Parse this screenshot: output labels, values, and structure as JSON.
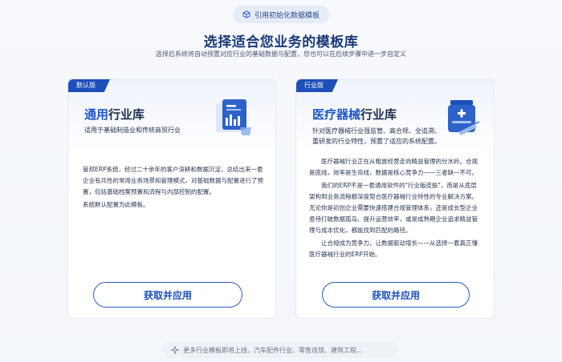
{
  "top_pill": {
    "label": "引用初始化数据模板",
    "icon": "cube-icon"
  },
  "title": "选择适合您业务的模板库",
  "subtitle": "选择后系统将自动预置对应行业的基础数据与配置，您也可以在后续步骤中进一步自定义",
  "cards": [
    {
      "tag": "默认版",
      "title_accent": "通用",
      "title_rest": "行业库",
      "desc": "适用于基础制造业和传统商贸行业",
      "body": [
        "管邦ERP系统，经过二十余年的客户深耕和数据沉淀，总结出来一套企业有共性的常用业务场景和管理模式，对基础数据与配置进行了预置，包括基础档案预置和流程与内部控制的配置。",
        "系统默认配置为此模板。"
      ],
      "button": "获取并应用",
      "icon": "document-chart-icon"
    },
    {
      "tag": "行业版",
      "title_accent": "医疗器械",
      "title_rest": "行业库",
      "desc": "针对医疗器械行业强监管、高合规、全追溯、重研发的行业特性，预置了适应的系统配置。",
      "body": [
        "医疗器械行业正在从粗放经营走向精益管理的分水岭。合规是底线，效率是生命线，数据是核心竞争力——三者缺一不可。",
        "我们的ERP不是一套通用软件的\"行业版皮肤\"，而是从底层架构到业务流程都深度契合医疗器械行业特性的专业解决方案。无论你是初创企业需要快速搭建合规管理体系，还是成长型企业亟待打破数据孤岛、提升运营效率，或是成熟期企业追求精益管理与成本优化，都能找到匹配的路径。",
        "让合规成为竞争力，让数据驱动增长——从选择一套真正懂医疗器械行业的ERP开始。"
      ],
      "button": "获取并应用",
      "icon": "medicine-bottle-syringe-icon"
    }
  ],
  "footer": {
    "text": "更多行业模板即将上线，汽车配件行业、零售连锁、建筑工程…",
    "icon": "sparkle-icon"
  },
  "colors": {
    "primary": "#1d4fb8",
    "accent": "#1d56c8",
    "background": "#f4f6fa"
  }
}
